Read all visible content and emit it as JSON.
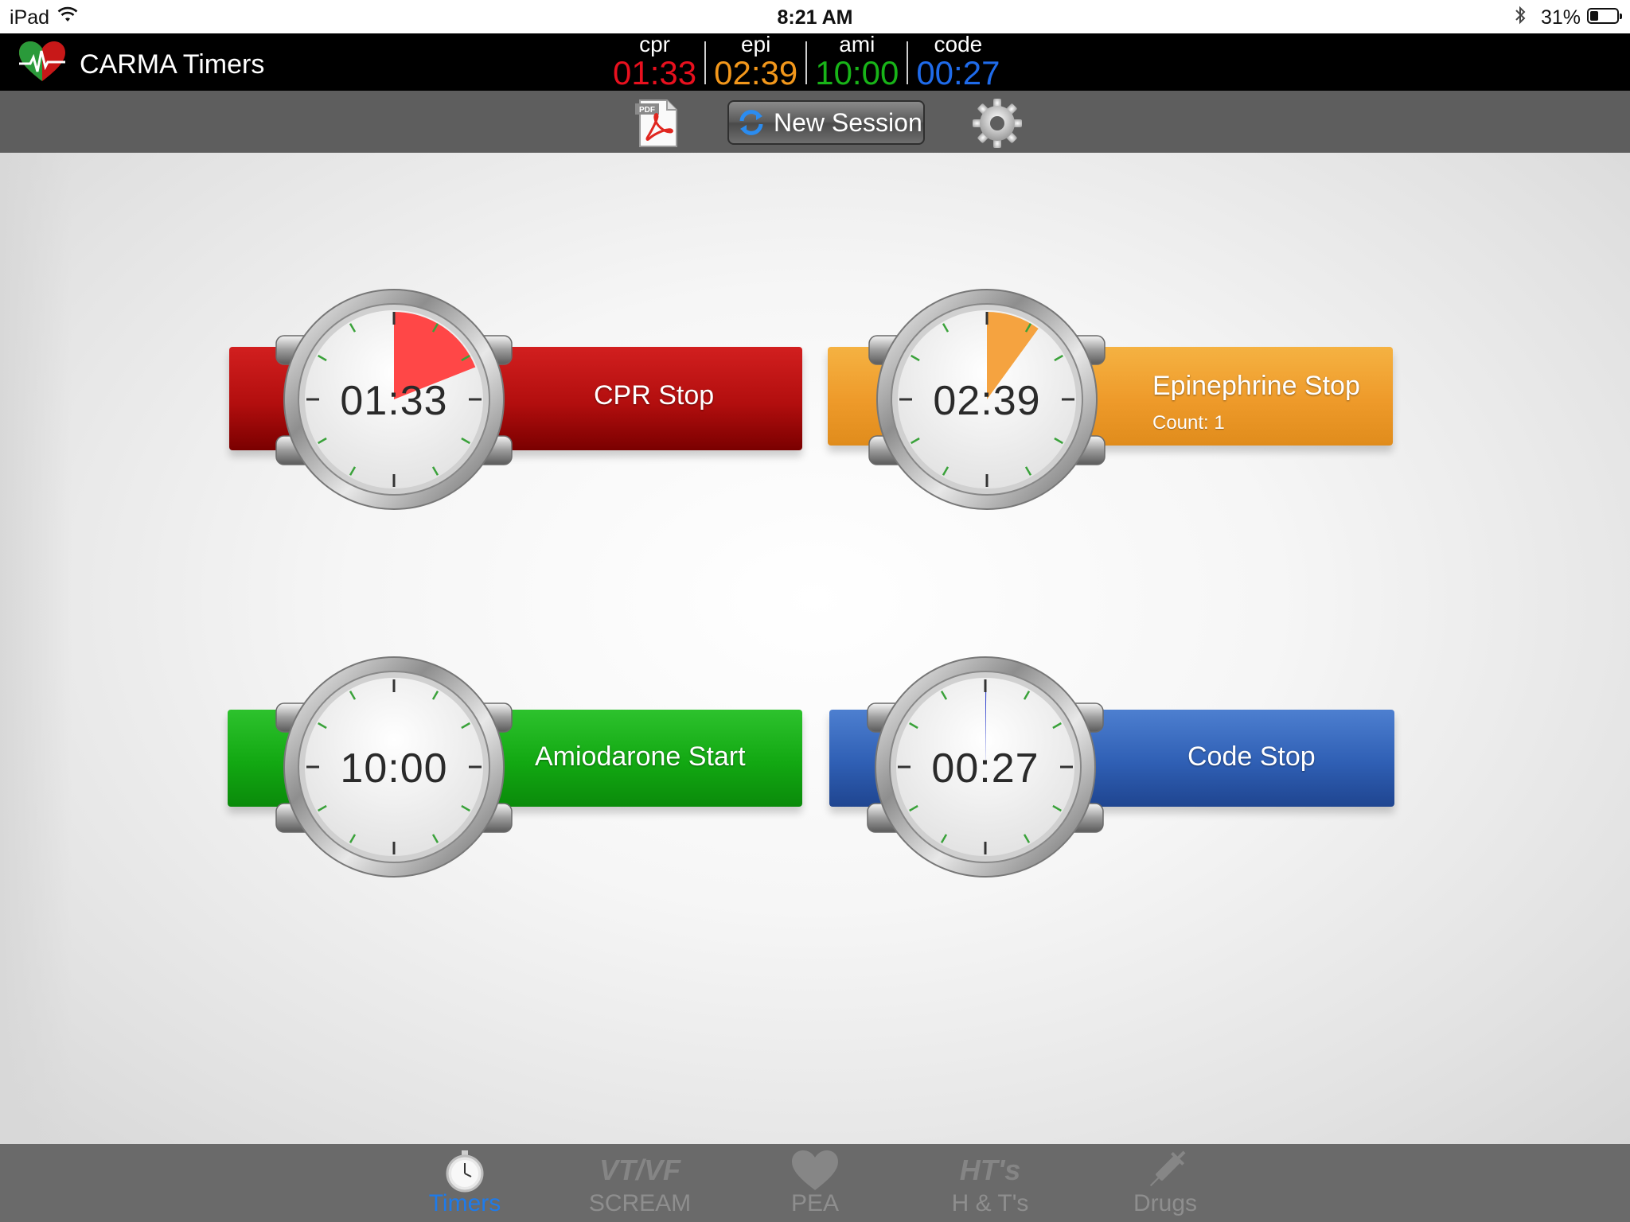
{
  "status_bar": {
    "carrier": "iPad",
    "time": "8:21 AM",
    "battery_text": "31%",
    "battery_level": 0.31
  },
  "app": {
    "title": "CARMA Timers"
  },
  "summary": [
    {
      "label": "cpr",
      "value": "01:33",
      "color": "#e8101e"
    },
    {
      "label": "epi",
      "value": "02:39",
      "color": "#f2971b"
    },
    {
      "label": "ami",
      "value": "10:00",
      "color": "#18b418"
    },
    {
      "label": "code",
      "value": "00:27",
      "color": "#1f6bea"
    }
  ],
  "toolbar": {
    "pdf_badge": "PDF",
    "new_session_label": "New Session"
  },
  "timers": {
    "cpr": {
      "readout": "01:33",
      "button_label": "CPR Stop",
      "progress_fraction": 0.19,
      "accent": "#ff4747"
    },
    "epi": {
      "readout": "02:39",
      "button_label": "Epinephrine Stop",
      "count_text": "Count: 1",
      "progress_fraction": 0.1,
      "accent": "#f5a340"
    },
    "ami": {
      "readout": "10:00",
      "button_label": "Amiodarone Start",
      "progress_fraction": 0,
      "accent": "#18b418"
    },
    "code": {
      "readout": "00:27",
      "button_label": "Code Stop",
      "progress_fraction": 0.002,
      "accent": "#3a4bd0"
    }
  },
  "tabs": [
    {
      "label": "Timers",
      "icon": "stopwatch-icon",
      "active": true
    },
    {
      "label": "SCREAM",
      "icon_text": "VT/VF",
      "active": false
    },
    {
      "label": "PEA",
      "icon": "heart-icon",
      "active": false
    },
    {
      "label": "H & T's",
      "icon_text": "HT's",
      "active": false
    },
    {
      "label": "Drugs",
      "icon": "syringe-icon",
      "active": false
    }
  ]
}
